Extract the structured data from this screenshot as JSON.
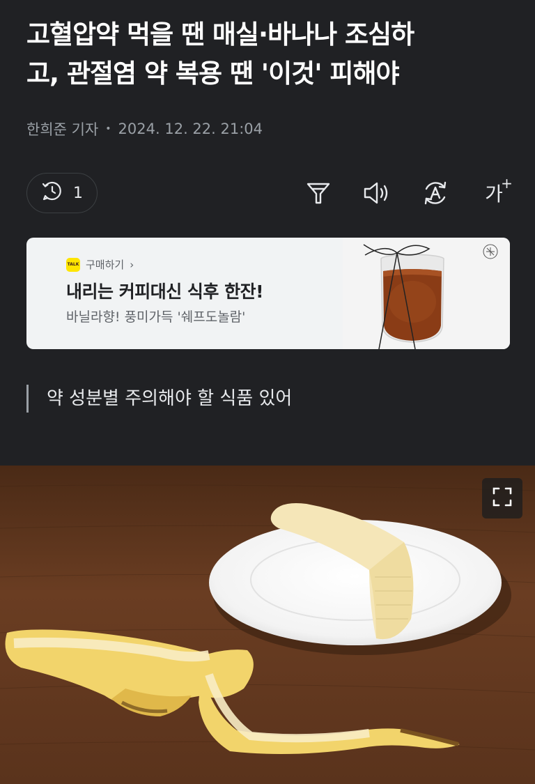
{
  "article": {
    "headline_line1": "고혈압약 먹을 땐 매실·바나나 조심하",
    "headline_line2": "고, 관절염 약 복용 땐 '이것' 피해야",
    "author": "한희준 기자",
    "date": "2024. 12. 22. 21:04",
    "subheading": "약 성분별 주의해야 할 식품 있어"
  },
  "toolbar": {
    "comment_count": "1",
    "font_size_label": "가",
    "font_size_sup": "+"
  },
  "ad": {
    "source_label": "구매하기",
    "source_chevron": "›",
    "talk_badge": "TALK",
    "title": "내리는 커피대신 식후 한잔!",
    "subtitle": "바닐라향! 풍미가득 '쉐프도놀람'"
  },
  "icons": {
    "comment": "history-comment-icon",
    "filter": "filter-icon",
    "speaker": "speaker-icon",
    "translate": "translate-icon",
    "font": "font-size-icon",
    "expand": "expand-icon"
  },
  "colors": {
    "background": "#202124",
    "ad_background": "#f1f3f4",
    "talk_yellow": "#fee500",
    "table_wood": "#5b3620",
    "banana_yellow": "#f2d46b"
  }
}
